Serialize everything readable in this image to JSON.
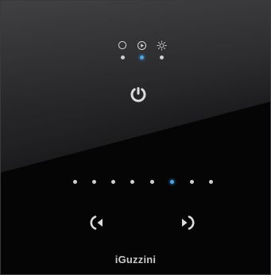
{
  "brand": {
    "name": "iGuzzini"
  },
  "modes": {
    "icons": [
      "ring-icon",
      "play-circle-icon",
      "sun-icon"
    ],
    "active_index": 1
  },
  "power": {
    "icon": "power-icon"
  },
  "brightness": {
    "levels": 8,
    "active_level": 6
  },
  "navigation": {
    "prev_icon": "chevron-left-icon",
    "next_icon": "chevron-right-icon"
  },
  "colors": {
    "icon": "#d6d6d8",
    "dot_idle": "#cfcfd2",
    "dot_active": "#4aa6e8",
    "panel": "#111112"
  }
}
